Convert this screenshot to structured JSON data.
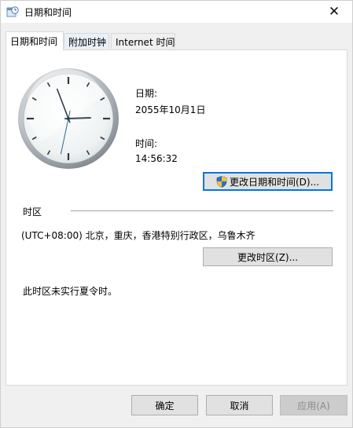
{
  "window": {
    "title": "日期和时间",
    "icons": {
      "app": "clock-calendar-icon",
      "close": "close-icon"
    },
    "close_glyph": "✕"
  },
  "tabs": [
    {
      "label": "日期和时间",
      "active": true
    },
    {
      "label": "附加时钟",
      "active": false
    },
    {
      "label": "Internet 时间",
      "active": false
    }
  ],
  "clock": {
    "hours": 14,
    "minutes": 56,
    "seconds": 32
  },
  "date_label": "日期:",
  "date_value": "2055年10月1日",
  "time_label": "时间:",
  "time_value": "14:56:32",
  "change_datetime_button": "更改日期和时间(D)...",
  "timezone": {
    "section_label": "时区",
    "value": "(UTC+08:00) 北京，重庆，香港特别行政区，乌鲁木齐",
    "change_button": "更改时区(Z)...",
    "dst_note": "此时区未实行夏令时。"
  },
  "footer": {
    "ok": "确定",
    "cancel": "取消",
    "apply": "应用(A)"
  },
  "colors": {
    "accent": "#0078d7",
    "panel_bg": "#ffffff",
    "window_bg": "#f0f0f0"
  }
}
